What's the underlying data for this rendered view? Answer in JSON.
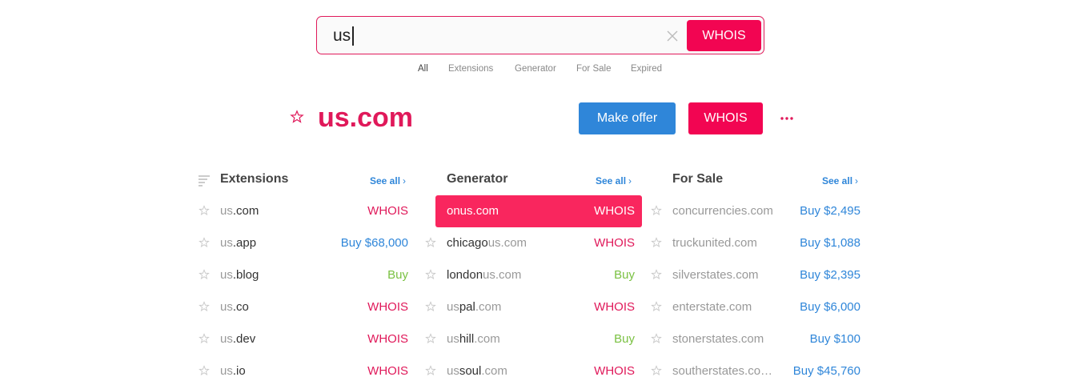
{
  "search": {
    "value": "us",
    "button_label": "WHOIS"
  },
  "filters": [
    {
      "label": "All",
      "active": true
    },
    {
      "label": "Extensions",
      "active": false
    },
    {
      "label": "Generator",
      "active": false
    },
    {
      "label": "For Sale",
      "active": false
    },
    {
      "label": "Expired",
      "active": false
    }
  ],
  "domain": {
    "title": "us.com",
    "offer_label": "Make offer",
    "whois_label": "WHOIS"
  },
  "columns": {
    "extensions": {
      "title": "Extensions",
      "see_all": "See all",
      "rows": [
        {
          "prefix": "us",
          "suffix": ".com",
          "action": "WHOIS"
        },
        {
          "prefix": "us",
          "suffix": ".app",
          "action": "Buy $68,000"
        },
        {
          "prefix": "us",
          "suffix": ".blog",
          "action": "Buy"
        },
        {
          "prefix": "us",
          "suffix": ".co",
          "action": "WHOIS"
        },
        {
          "prefix": "us",
          "suffix": ".dev",
          "action": "WHOIS"
        },
        {
          "prefix": "us",
          "suffix": ".io",
          "action": "WHOIS"
        }
      ]
    },
    "generator": {
      "title": "Generator",
      "see_all": "See all",
      "rows": [
        {
          "dark": "onus",
          "light": ".com",
          "action": "WHOIS"
        },
        {
          "dark": "chicago",
          "light": "us.com",
          "action": "WHOIS"
        },
        {
          "dark": "london",
          "light": "us.com",
          "action": "Buy"
        },
        {
          "dark_a": "us",
          "dark": "pal",
          "light": ".com",
          "action": "WHOIS"
        },
        {
          "dark_a": "us",
          "dark": "hill",
          "light": ".com",
          "action": "Buy"
        },
        {
          "dark_a": "us",
          "dark": "soul",
          "light": ".com",
          "action": "WHOIS"
        }
      ]
    },
    "forsale": {
      "title": "For Sale",
      "see_all": "See all",
      "rows": [
        {
          "name": "concurrencies.com",
          "action": "Buy $2,495"
        },
        {
          "name": "truckunited.com",
          "action": "Buy $1,088"
        },
        {
          "name": "silverstates.com",
          "action": "Buy $2,395"
        },
        {
          "name": "enterstate.com",
          "action": "Buy $6,000"
        },
        {
          "name": "stonerstates.com",
          "action": "Buy $100"
        },
        {
          "name": "southerstates.co…",
          "action": "Buy $45,760"
        }
      ]
    }
  },
  "colors": {
    "accent_pink": "#f20552",
    "accent_blue": "#2f86d9",
    "buy_green": "#7ac142"
  }
}
